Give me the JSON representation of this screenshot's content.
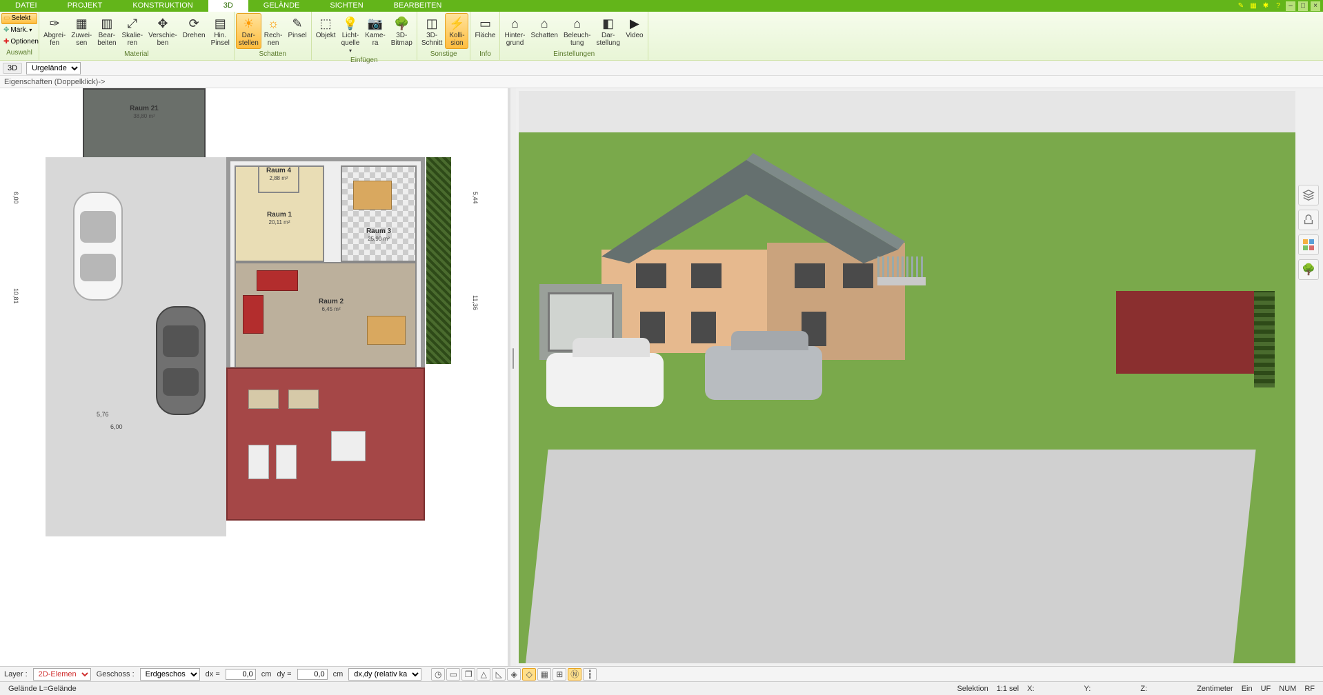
{
  "tabs": {
    "datei": "DATEI",
    "projekt": "PROJEKT",
    "konstruktion": "KONSTRUKTION",
    "d3": "3D",
    "gelaende": "GELÄNDE",
    "sichten": "SICHTEN",
    "bearbeiten": "BEARBEITEN"
  },
  "sel": {
    "selekt": "Selekt",
    "mark": "Mark.",
    "optionen": "Optionen"
  },
  "groups": {
    "auswahl": "Auswahl",
    "material": "Material",
    "schatten": "Schatten",
    "einfuegen": "Einfügen",
    "sonstige": "Sonstige",
    "info": "Info",
    "einstellungen": "Einstellungen"
  },
  "btn": {
    "abgreifen": "Abgrei-\nfen",
    "zuweisen": "Zuwei-\nsen",
    "bearbeiten": "Bear-\nbeiten",
    "skalieren": "Skalie-\nren",
    "verschieben": "Verschie-\nben",
    "drehen": "Drehen",
    "hinpinsel": "Hin.\nPinsel",
    "darstellen": "Dar-\nstellen",
    "rechnen": "Rech-\nnen",
    "pinsel": "Pinsel",
    "objekt": "Objekt",
    "lichtquelle": "Licht-\nquelle",
    "kamera": "Kame-\nra",
    "bitmap": "3D-\nBitmap",
    "schnitt": "3D-\nSchnitt",
    "kollision": "Kolli-\nsion",
    "flaeche": "Fläche",
    "hintergrund": "Hinter-\ngrund",
    "schattenE": "Schatten",
    "beleuchtung": "Beleuch-\ntung",
    "darstellung": "Dar-\nstellung",
    "video": "Video"
  },
  "sub": {
    "mode": "3D",
    "view": "Urgelände"
  },
  "prop": {
    "text": "Eigenschaften (Doppelklick)->"
  },
  "plan": {
    "raum21": "Raum 21",
    "raum21m": "38,80 m²",
    "raum4": "Raum 4",
    "raum4m": "2,88 m²",
    "raum1": "Raum 1",
    "raum1m": "20,11 m²",
    "raum3": "Raum 3",
    "raum3m": "25,90 m²",
    "raum2": "Raum 2",
    "raum2m": "6,45 m²"
  },
  "bottom": {
    "layer": "Layer :",
    "layer_val": "2D-Elemen",
    "geschoss": "Geschoss :",
    "geschoss_val": "Erdgeschos",
    "dx": "dx =",
    "dy": "dy =",
    "dx_val": "0,0",
    "dy_val": "0,0",
    "unit": "cm",
    "mode": "dx,dy (relativ ka"
  },
  "status": {
    "left": "Gelände L=Gelände",
    "sel": "Selektion",
    "ratio": "1:1 sel",
    "x": "X:",
    "y": "Y:",
    "z": "Z:",
    "unit": "Zentimeter",
    "ein": "Ein",
    "uf": "UF",
    "num": "NUM",
    "rf": "RF"
  },
  "side": {
    "layers": "≋",
    "chair": "♞",
    "palette": "▤",
    "tree": "✿"
  }
}
